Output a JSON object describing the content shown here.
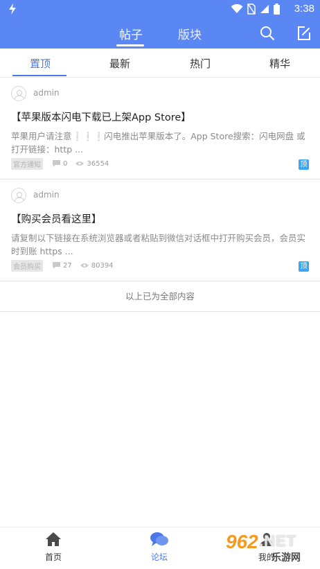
{
  "status_bar": {
    "time": "3:38"
  },
  "header": {
    "tabs": [
      {
        "label": "帖子",
        "active": true
      },
      {
        "label": "版块",
        "active": false
      }
    ]
  },
  "subtabs": [
    {
      "label": "置顶",
      "active": true
    },
    {
      "label": "最新",
      "active": false
    },
    {
      "label": "热门",
      "active": false
    },
    {
      "label": "精华",
      "active": false
    }
  ],
  "posts": [
    {
      "author": "admin",
      "title": "【苹果版本闪电下载已上架App Store】",
      "summary_before": "苹果用户请注意",
      "summary_excl": "❕❕❕",
      "summary_after": "闪电推出苹果版本了。App Store搜索：闪电网盘 或打开链接：http ...",
      "tag": "官方通知",
      "comments": "0",
      "views": "36554",
      "pin_label": "顶"
    },
    {
      "author": "admin",
      "title": "【购买会员看这里】",
      "summary_before": "请复制以下链接在系统浏览器或者粘贴到微信对话框中打开购买会员，会员实时到账 https ...",
      "summary_excl": "",
      "summary_after": "",
      "tag": "会员购买",
      "comments": "27",
      "views": "80394",
      "pin_label": "顶"
    }
  ],
  "end_note": "以上已为全部内容",
  "bottom_nav": [
    {
      "label": "首页",
      "icon": "home-icon",
      "active": false
    },
    {
      "label": "论坛",
      "icon": "forum-icon",
      "active": true
    },
    {
      "label": "我的",
      "icon": "profile-icon",
      "active": false
    }
  ],
  "watermark": {
    "number": "962",
    "suffix": ".NET",
    "site": "乐游网"
  },
  "colors": {
    "primary": "#5b87f5",
    "accent": "#4a78e8",
    "pin": "#3aa7f0"
  }
}
